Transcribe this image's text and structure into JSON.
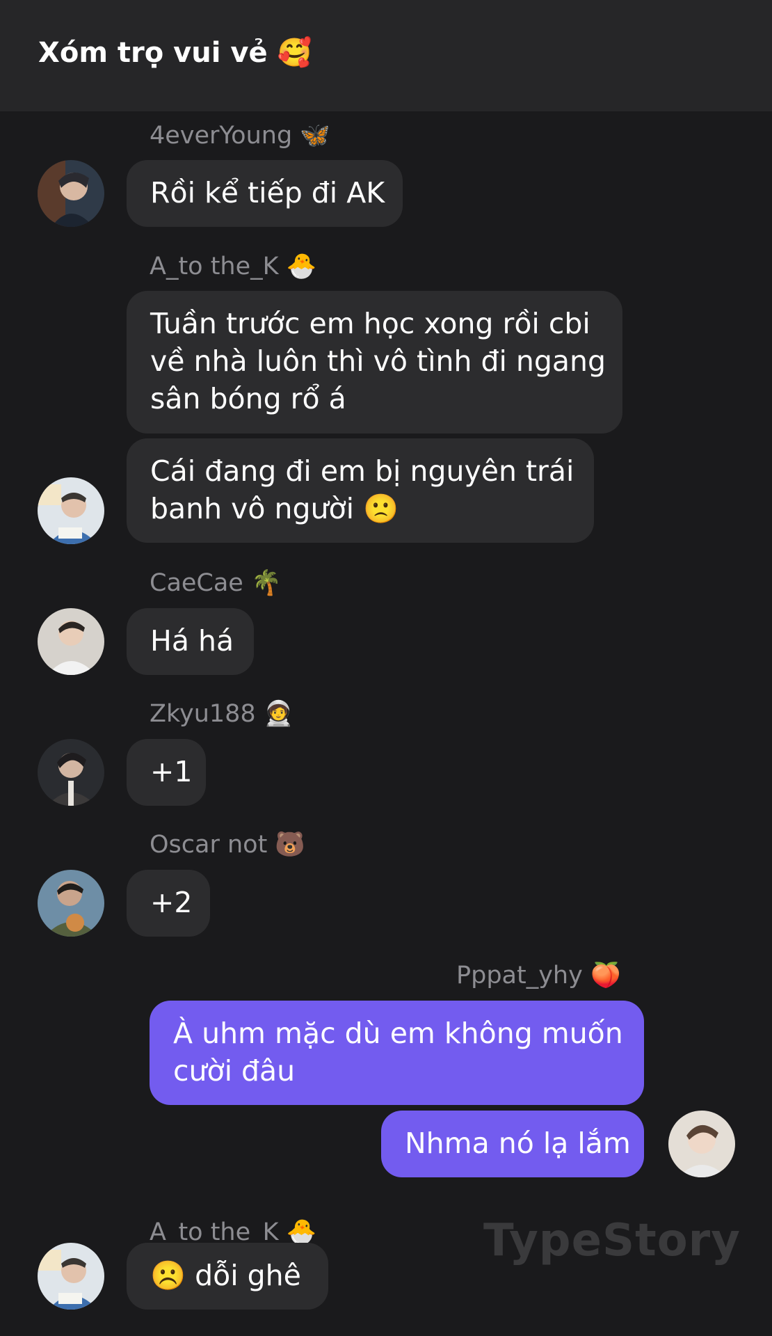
{
  "header": {
    "title": "Xóm trọ vui vẻ 🥰"
  },
  "messages": [
    {
      "sender": "4everYoung 🦋",
      "text": "Rồi kể tiếp đi AK"
    },
    {
      "sender": "A_to the_K 🐣",
      "text_lines": [
        "Tuần trước em học xong rồi cbi",
        "về nhà luôn thì vô tình đi ngang",
        "sân bóng rổ á"
      ]
    },
    {
      "text_lines": [
        "Cái đang đi em bị nguyên trái",
        "banh vô người 🙁"
      ]
    },
    {
      "sender": "CaeCae 🌴",
      "text": "Há há"
    },
    {
      "sender": "Zkyu188 🧑‍🚀",
      "text": "+1"
    },
    {
      "sender": "Oscar not 🐻",
      "text": "+2"
    },
    {
      "sender": "Pppat_yhy 🍑",
      "text_lines": [
        "À uhm mặc dù em không muốn",
        "cười đâu"
      ]
    },
    {
      "text": "Nhma nó lạ lắm"
    },
    {
      "sender": "A_to the_K 🐣",
      "text": "☹️ dỗi ghê"
    }
  ],
  "watermark": "TypeStory",
  "colors": {
    "background": "#1a1a1c",
    "header": "#262628",
    "bubble_other": "#2c2c2e",
    "bubble_me": "#735cef",
    "sender_name": "#8d8d92"
  },
  "icons": [
    "avatar-4everyoung",
    "avatar-a-to-the-k",
    "avatar-caecae",
    "avatar-zkyu188",
    "avatar-oscar-not",
    "avatar-pppat-yhy"
  ]
}
